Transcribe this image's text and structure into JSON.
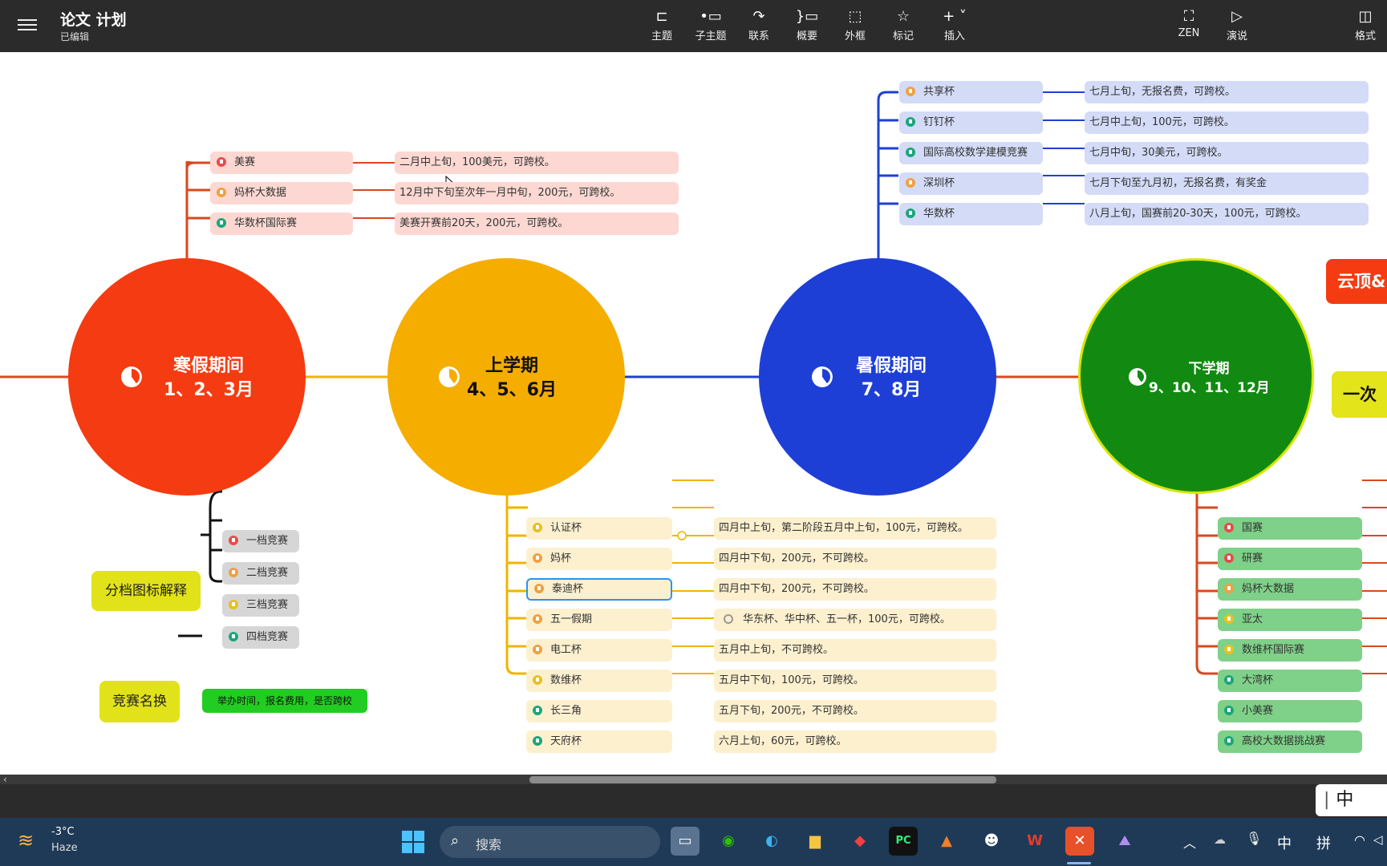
{
  "header": {
    "title": "论文 计划",
    "status": "已编辑",
    "tools": [
      {
        "label": "主题",
        "icon": "topic-icon"
      },
      {
        "label": "子主题",
        "icon": "subtopic-icon"
      },
      {
        "label": "联系",
        "icon": "relationship-icon"
      },
      {
        "label": "概要",
        "icon": "summary-icon"
      },
      {
        "label": "外框",
        "icon": "boundary-icon"
      },
      {
        "label": "标记",
        "icon": "star-icon"
      },
      {
        "label": "插入",
        "icon": "plus-icon"
      }
    ],
    "right_tools": [
      {
        "label": "ZEN",
        "icon": "zen-icon"
      },
      {
        "label": "演说",
        "icon": "pitch-icon"
      },
      {
        "label": "格式",
        "icon": "format-panel-icon"
      }
    ]
  },
  "colors": {
    "winter": "#f53b12",
    "spring": "#f5ad00",
    "summer": "#1e3fd6",
    "autumn": "#128a12",
    "red_flag": "#e84b4b",
    "orange_flag": "#f0a040",
    "yellow_flag": "#e8c020",
    "teal_flag": "#1aa67a"
  },
  "periods": {
    "winter": {
      "title": "寒假期间",
      "months": "1、2、3月"
    },
    "spring": {
      "title": "上学期",
      "months": "4、5、6月"
    },
    "summer": {
      "title": "暑假期间",
      "months": "7、8月"
    },
    "autumn": {
      "title": "下学期",
      "months": "9、10、11、12月"
    }
  },
  "partial_topics": {
    "top": "云顶&",
    "bottom": "一次"
  },
  "winter_items": [
    {
      "name": "美赛",
      "desc": "二月中上旬，100美元，可跨校。",
      "flag": "red"
    },
    {
      "name": "妈杯大数据",
      "desc": "12月中下旬至次年一月中旬，200元，可跨校。",
      "flag": "orange"
    },
    {
      "name": "华数杯国际赛",
      "desc": "美赛开赛前20天，200元，可跨校。",
      "flag": "teal"
    }
  ],
  "summer_items": [
    {
      "name": "共享杯",
      "desc": "七月上旬，无报名费，可跨校。",
      "flag": "orange"
    },
    {
      "name": "钉钉杯",
      "desc": "七月中上旬，100元，可跨校。",
      "flag": "teal"
    },
    {
      "name": "国际高校数学建模竞赛",
      "desc": "七月中旬，30美元，可跨校。",
      "flag": "teal"
    },
    {
      "name": "深圳杯",
      "desc": "七月下旬至九月初，无报名费，有奖金",
      "flag": "orange"
    },
    {
      "name": "华数杯",
      "desc": "八月上旬，国赛前20-30天，100元，可跨校。",
      "flag": "teal"
    }
  ],
  "spring_items": [
    {
      "name": "认证杯",
      "desc": "四月中上旬，第二阶段五月中上旬，100元，可跨校。",
      "flag": "yellow"
    },
    {
      "name": "妈杯",
      "desc": "四月中下旬，200元，不可跨校。",
      "flag": "orange"
    },
    {
      "name": "泰迪杯",
      "desc": "四月中下旬，200元，不可跨校。",
      "flag": "orange"
    },
    {
      "name": "五一假期",
      "desc": "华东杯、华中杯、五一杯，100元，可跨校。",
      "flag": "orange"
    },
    {
      "name": "电工杯",
      "desc": "五月中上旬，不可跨校。",
      "flag": "orange"
    },
    {
      "name": "数维杯",
      "desc": "五月中下旬，100元，可跨校。",
      "flag": "yellow"
    },
    {
      "name": "长三角",
      "desc": "五月下旬，200元，不可跨校。",
      "flag": "teal"
    },
    {
      "name": "天府杯",
      "desc": "六月上旬，60元，可跨校。",
      "flag": "teal"
    }
  ],
  "autumn_items": [
    {
      "name": "国赛",
      "flag": "red"
    },
    {
      "name": "研赛",
      "flag": "red"
    },
    {
      "name": "妈杯大数据",
      "flag": "orange"
    },
    {
      "name": "亚太",
      "flag": "yellow"
    },
    {
      "name": "数维杯国际赛",
      "flag": "yellow"
    },
    {
      "name": "大湾杯",
      "flag": "teal"
    },
    {
      "name": "小美赛",
      "flag": "teal"
    },
    {
      "name": "高校大数据挑战赛",
      "flag": "teal"
    }
  ],
  "legend": {
    "title": "分档图标解释",
    "levels": [
      {
        "name": "一档竞赛",
        "flag": "red"
      },
      {
        "name": "二档竞赛",
        "flag": "orange"
      },
      {
        "name": "三档竞赛",
        "flag": "yellow"
      },
      {
        "name": "四档竞赛",
        "flag": "teal"
      }
    ]
  },
  "naming": {
    "title": "竞赛名换",
    "desc": "举办时间，报名费用，是否跨校"
  },
  "taskbar": {
    "temp": "-3°C",
    "weather": "Haze",
    "search": "搜索",
    "ime_lang": "中",
    "ime_mode": "拼",
    "ime_box": "中"
  }
}
